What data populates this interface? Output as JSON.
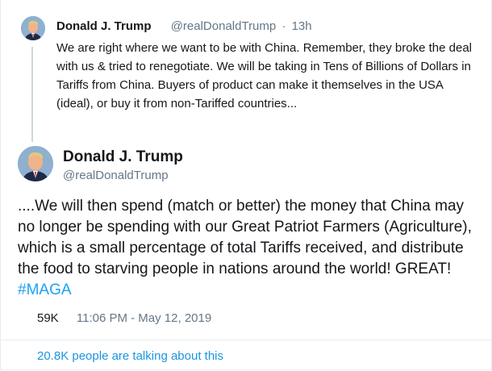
{
  "reply_tweet": {
    "author_name": "Donald J. Trump",
    "handle": "@realDonaldTrump",
    "separator": "·",
    "time": "13h",
    "text": "We are right where we want to be with China. Remember, they broke the deal with us & tried to renegotiate. We will be taking in Tens of Billions of Dollars in Tariffs from China. Buyers of product can make it themselves in the USA (ideal), or buy it from non-Tariffed countries..."
  },
  "main_tweet": {
    "author_name": "Donald J. Trump",
    "handle": "@realDonaldTrump",
    "text": "....We will then spend (match or better) the money that China may no longer be spending with our Great Patriot Farmers (Agriculture), which is a small percentage of total Tariffs received, and distribute the food to starving people in nations around the world! GREAT! ",
    "hashtag": "#MAGA",
    "likes": "59K",
    "timestamp": "11:06 PM - May 12, 2019"
  },
  "talking_link": "20.8K people are talking about this",
  "colors": {
    "link_blue": "#1da1f2",
    "secondary_gray": "#657786",
    "text_black": "#14171a",
    "divider": "#e6ecf0"
  }
}
